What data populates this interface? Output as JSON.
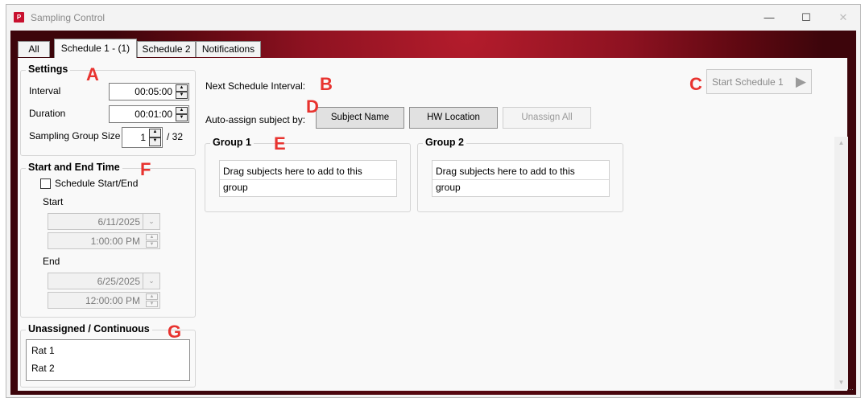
{
  "window": {
    "title": "Sampling Control",
    "icon_label": "P"
  },
  "tabs": [
    {
      "label": "All"
    },
    {
      "label": "Schedule 1 - (1)"
    },
    {
      "label": "Schedule 2"
    },
    {
      "label": "Notifications"
    }
  ],
  "settings": {
    "title": "Settings",
    "interval_label": "Interval",
    "interval_value": "00:05:00",
    "duration_label": "Duration",
    "duration_value": "00:01:00",
    "group_size_label": "Sampling Group Size",
    "group_size_value": "1",
    "group_size_max": "/ 32"
  },
  "start_end": {
    "title": "Start and End Time",
    "checkbox_label": "Schedule Start/End",
    "checked": false,
    "start_label": "Start",
    "start_date": "6/11/2025",
    "start_time": "1:00:00 PM",
    "end_label": "End",
    "end_date": "6/25/2025",
    "end_time": "12:00:00 PM"
  },
  "unassigned": {
    "title": "Unassigned / Continuous",
    "items": [
      "Rat 1",
      "Rat 2"
    ]
  },
  "main": {
    "next_interval_label": "Next Schedule Interval:",
    "auto_assign_label": "Auto-assign subject by:",
    "subject_name_button": "Subject Name",
    "hw_location_button": "HW Location",
    "unassign_all_button": "Unassign All",
    "start_button": "Start Schedule 1"
  },
  "groups": [
    {
      "title": "Group 1",
      "drop_line1": "Drag subjects here to add to this",
      "drop_line2": "group"
    },
    {
      "title": "Group 2",
      "drop_line1": "Drag subjects here to add to this",
      "drop_line2": "group"
    }
  ],
  "annotations": {
    "a": "A",
    "b": "B",
    "c": "C",
    "d": "D",
    "e": "E",
    "f": "F",
    "g": "G"
  },
  "colors": {
    "accent_red": "#e8332f",
    "background_dark_red": "#8e1221"
  }
}
